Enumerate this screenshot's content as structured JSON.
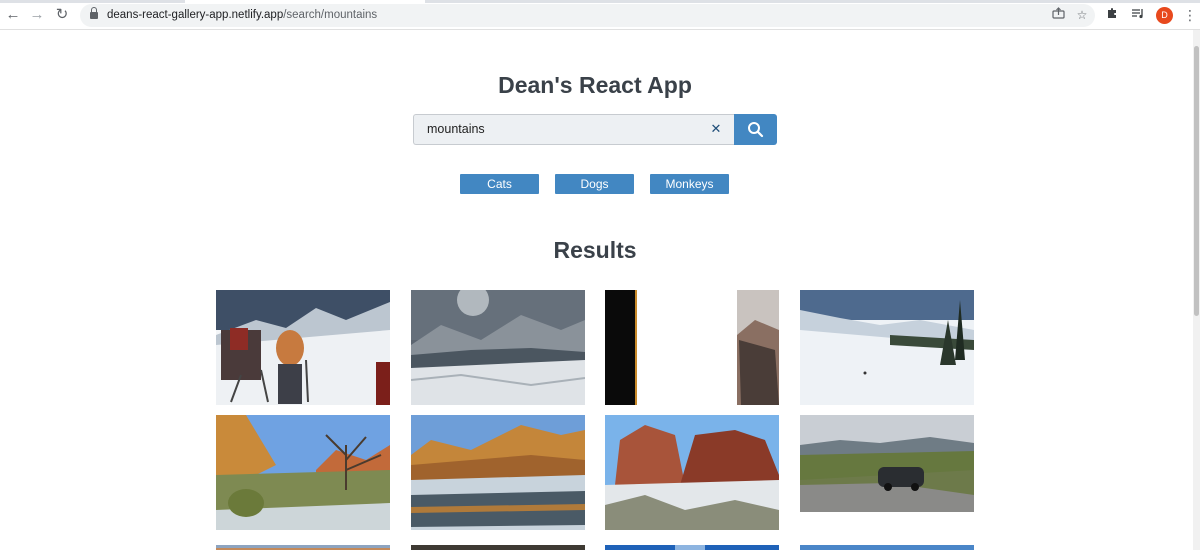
{
  "browser": {
    "url_host": "deans-react-gallery-app.netlify.app",
    "url_path": "/search/mountains",
    "profile_initial": "D"
  },
  "app": {
    "title": "Dean's React App",
    "results_heading": "Results"
  },
  "search": {
    "value": "mountains"
  },
  "nav": {
    "items": [
      "Cats",
      "Dogs",
      "Monkeys"
    ]
  },
  "colors": {
    "accent": "#4287c2",
    "heading": "#3a4149",
    "input_bg": "#edf0f3"
  },
  "icons": {
    "back": "arrow-left-icon",
    "forward": "arrow-right-icon",
    "reload": "reload-icon",
    "lock": "lock-icon",
    "share": "share-icon",
    "bookmark": "star-icon",
    "extensions": "puzzle-icon",
    "media": "playlist-icon",
    "menu": "kebab-icon",
    "clear": "close-icon",
    "search": "search-icon"
  }
}
